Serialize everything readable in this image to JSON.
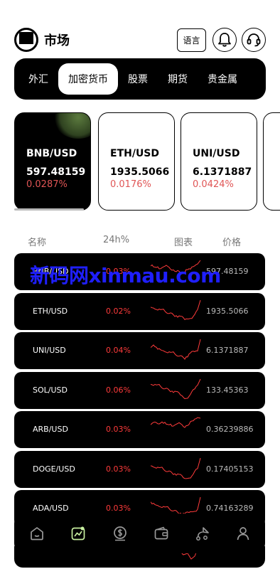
{
  "header": {
    "title": "市场",
    "lang_label": "语言"
  },
  "tabs": [
    "外汇",
    "加密货币",
    "股票",
    "期货",
    "贵金属"
  ],
  "active_tab": 1,
  "cards": [
    {
      "symbol": "BNB/USD",
      "price": "597.48159",
      "change": "0.0287%"
    },
    {
      "symbol": "ETH/USD",
      "price": "1935.5066",
      "change": "0.0176%"
    },
    {
      "symbol": "UNI/USD",
      "price": "6.1371887",
      "change": "0.0424%"
    }
  ],
  "columns": {
    "name": "名称",
    "change": "24h%",
    "chart": "图表",
    "price": "价格"
  },
  "rows": [
    {
      "symbol": "BNB/USD",
      "change": "0.03%",
      "price": "597.48159"
    },
    {
      "symbol": "ETH/USD",
      "change": "0.02%",
      "price": "1935.5066"
    },
    {
      "symbol": "UNI/USD",
      "change": "0.04%",
      "price": "6.1371887"
    },
    {
      "symbol": "SOL/USD",
      "change": "0.06%",
      "price": "133.45363"
    },
    {
      "symbol": "ARB/USD",
      "change": "0.03%",
      "price": "0.36239886"
    },
    {
      "symbol": "DOGE/USD",
      "change": "0.03%",
      "price": "0.17405153"
    },
    {
      "symbol": "ADA/USD",
      "change": "0.03%",
      "price": "0.74163289"
    }
  ],
  "watermark": "新码网xinmau.com",
  "bottom_nav": [
    {
      "icon": "home-icon"
    },
    {
      "icon": "market-chart-icon",
      "active": true
    },
    {
      "icon": "dollar-coin-icon"
    },
    {
      "icon": "wallet-icon"
    },
    {
      "icon": "route-icon"
    },
    {
      "icon": "user-icon"
    }
  ],
  "colors": {
    "accent_up": "#ff3b3b",
    "card_pct": "#e05555",
    "active_nav": "#c8f0a0"
  }
}
